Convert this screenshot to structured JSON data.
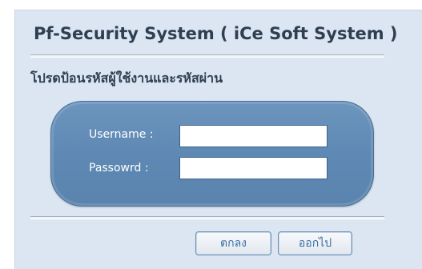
{
  "login": {
    "title": "Pf-Security System ( iCe Soft System )",
    "subtitle": "โปรดป้อนรหัสผู้ใช้งานและรหัสผ่าน",
    "username_label": "Username :",
    "password_label": "Passowrd :",
    "username_value": "",
    "password_value": "",
    "ok_label": "ตกลง",
    "exit_label": "ออกไป"
  },
  "colors": {
    "panel_background": "#dbe6f2",
    "form_box": "#5e89b4",
    "title_text": "#2e3f52",
    "button_text": "#3a6ea5"
  }
}
